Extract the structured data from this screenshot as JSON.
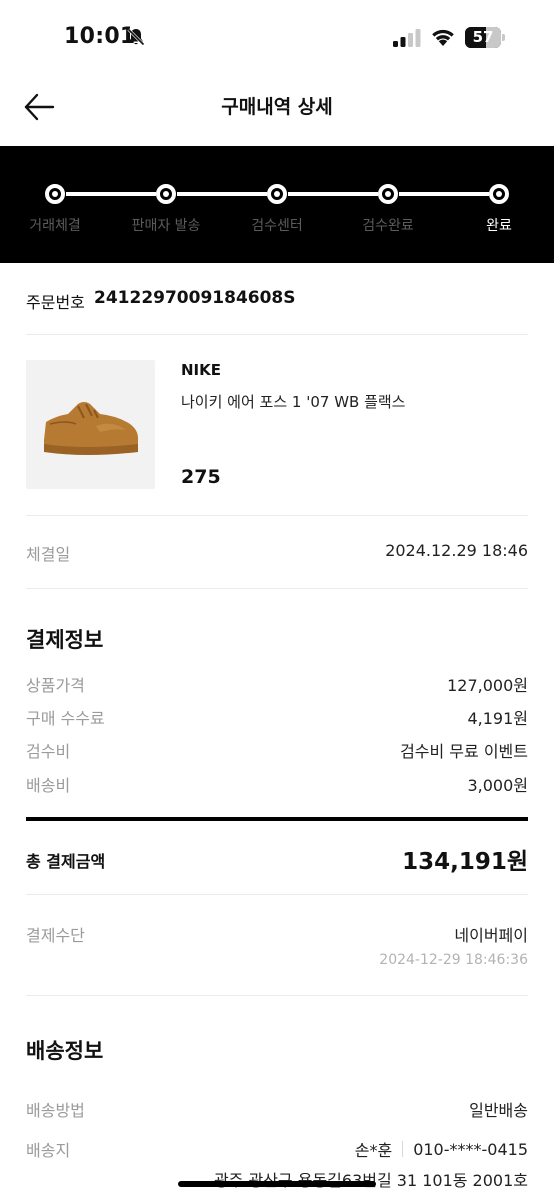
{
  "status_bar": {
    "time": "10:01",
    "battery": "57",
    "battery_level": 0.57
  },
  "header": {
    "title": "구매내역 상세"
  },
  "progress": {
    "steps": [
      "거래체결",
      "판매자 발송",
      "검수센터",
      "검수완료",
      "완료"
    ],
    "current_step": "완료"
  },
  "order": {
    "label": "주문번호",
    "number": "2412297009184608S"
  },
  "product": {
    "brand": "NIKE",
    "name": "나이키 에어 포스 1 '07 WB 플랙스",
    "size": "275",
    "image_icon": "sneaker-image"
  },
  "contract": {
    "label": "체결일",
    "value": "2024.12.29 18:46"
  },
  "payment": {
    "title": "결제정보",
    "rows": [
      {
        "label": "상품가격",
        "value": "127,000원"
      },
      {
        "label": "구매 수수료",
        "value": "4,191원"
      },
      {
        "label": "검수비",
        "value": "검수비 무료 이벤트"
      },
      {
        "label": "배송비",
        "value": "3,000원"
      }
    ],
    "total_label": "총 결제금액",
    "total_value": "134,191원",
    "method_label": "결제수단",
    "method_value": "네이버페이",
    "method_date": "2024-12-29 18:46:36"
  },
  "shipping": {
    "title": "배송정보",
    "method_label": "배송방법",
    "method_value": "일반배송",
    "address_label": "배송지",
    "recipient": "손*훈",
    "phone": "010-****-0415",
    "address": "광주 광산구 용동길63번길 31 101동 2001호"
  },
  "colors": {
    "progress_bg": "#000000",
    "muted_label": "#9b9b9b",
    "divider": "#ebebeb"
  }
}
